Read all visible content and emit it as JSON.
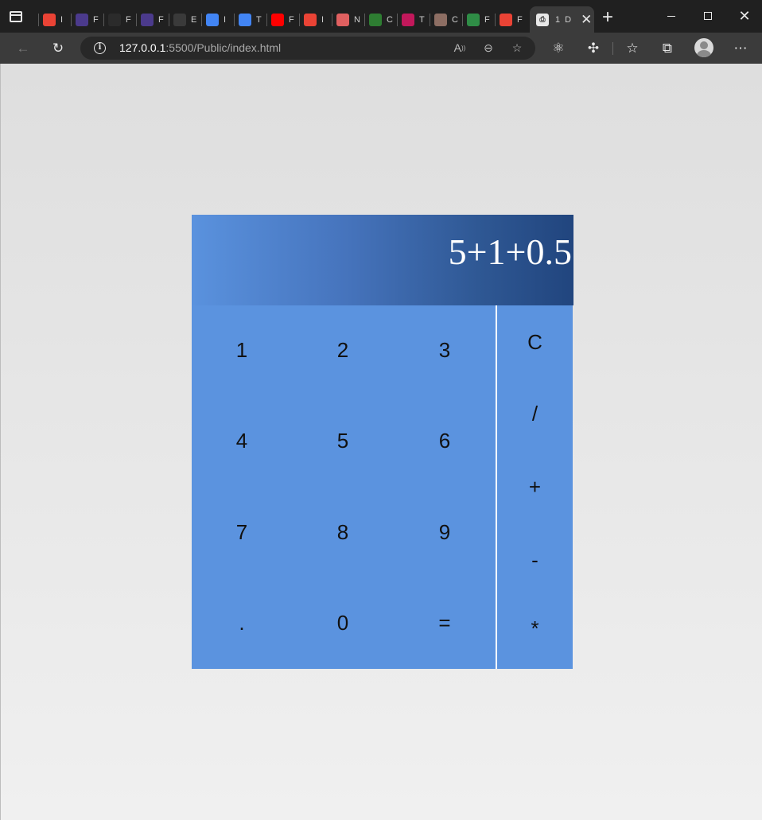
{
  "browser": {
    "tabs": [
      {
        "icon": "gmail-icon",
        "initial": "I",
        "color": "#ea4335"
      },
      {
        "icon": "list-icon",
        "initial": "F",
        "color": "#4b3a8c"
      },
      {
        "icon": "github-icon",
        "initial": "F",
        "color": "#2b2b2b"
      },
      {
        "icon": "list-icon",
        "initial": "F",
        "color": "#4b3a8c"
      },
      {
        "icon": "tally-icon",
        "initial": "E",
        "color": "#3a3a3a"
      },
      {
        "icon": "google-icon",
        "initial": "I",
        "color": "#4285f4"
      },
      {
        "icon": "docs-icon",
        "initial": "T",
        "color": "#4285f4"
      },
      {
        "icon": "youtube-icon",
        "initial": "F",
        "color": "#ff0000"
      },
      {
        "icon": "gmail-icon",
        "initial": "I",
        "color": "#ea4335"
      },
      {
        "icon": "record-icon",
        "initial": "N",
        "color": "#e06060"
      },
      {
        "icon": "camera-icon",
        "initial": "C",
        "color": "#2e7d32"
      },
      {
        "icon": "media-icon",
        "initial": "T",
        "color": "#c2185b"
      },
      {
        "icon": "cc-icon",
        "initial": "C",
        "color": "#8d6e63"
      },
      {
        "icon": "gfg-icon",
        "initial": "F",
        "color": "#2f8d46"
      },
      {
        "icon": "gmail-icon",
        "initial": "F",
        "color": "#ea4335"
      }
    ],
    "active_tab": {
      "icon": "file-icon",
      "initial": "1",
      "label": "D"
    },
    "address": {
      "host": "127.0.0.1",
      "rest": ":5500/Public/index.html"
    }
  },
  "calculator": {
    "display": "5+1+0.5",
    "keys": [
      [
        "1",
        "2",
        "3"
      ],
      [
        "4",
        "5",
        "6"
      ],
      [
        "7",
        "8",
        "9"
      ],
      [
        ".",
        "0",
        "="
      ]
    ],
    "operators": [
      "C",
      "/",
      "+",
      "-",
      "*"
    ]
  }
}
